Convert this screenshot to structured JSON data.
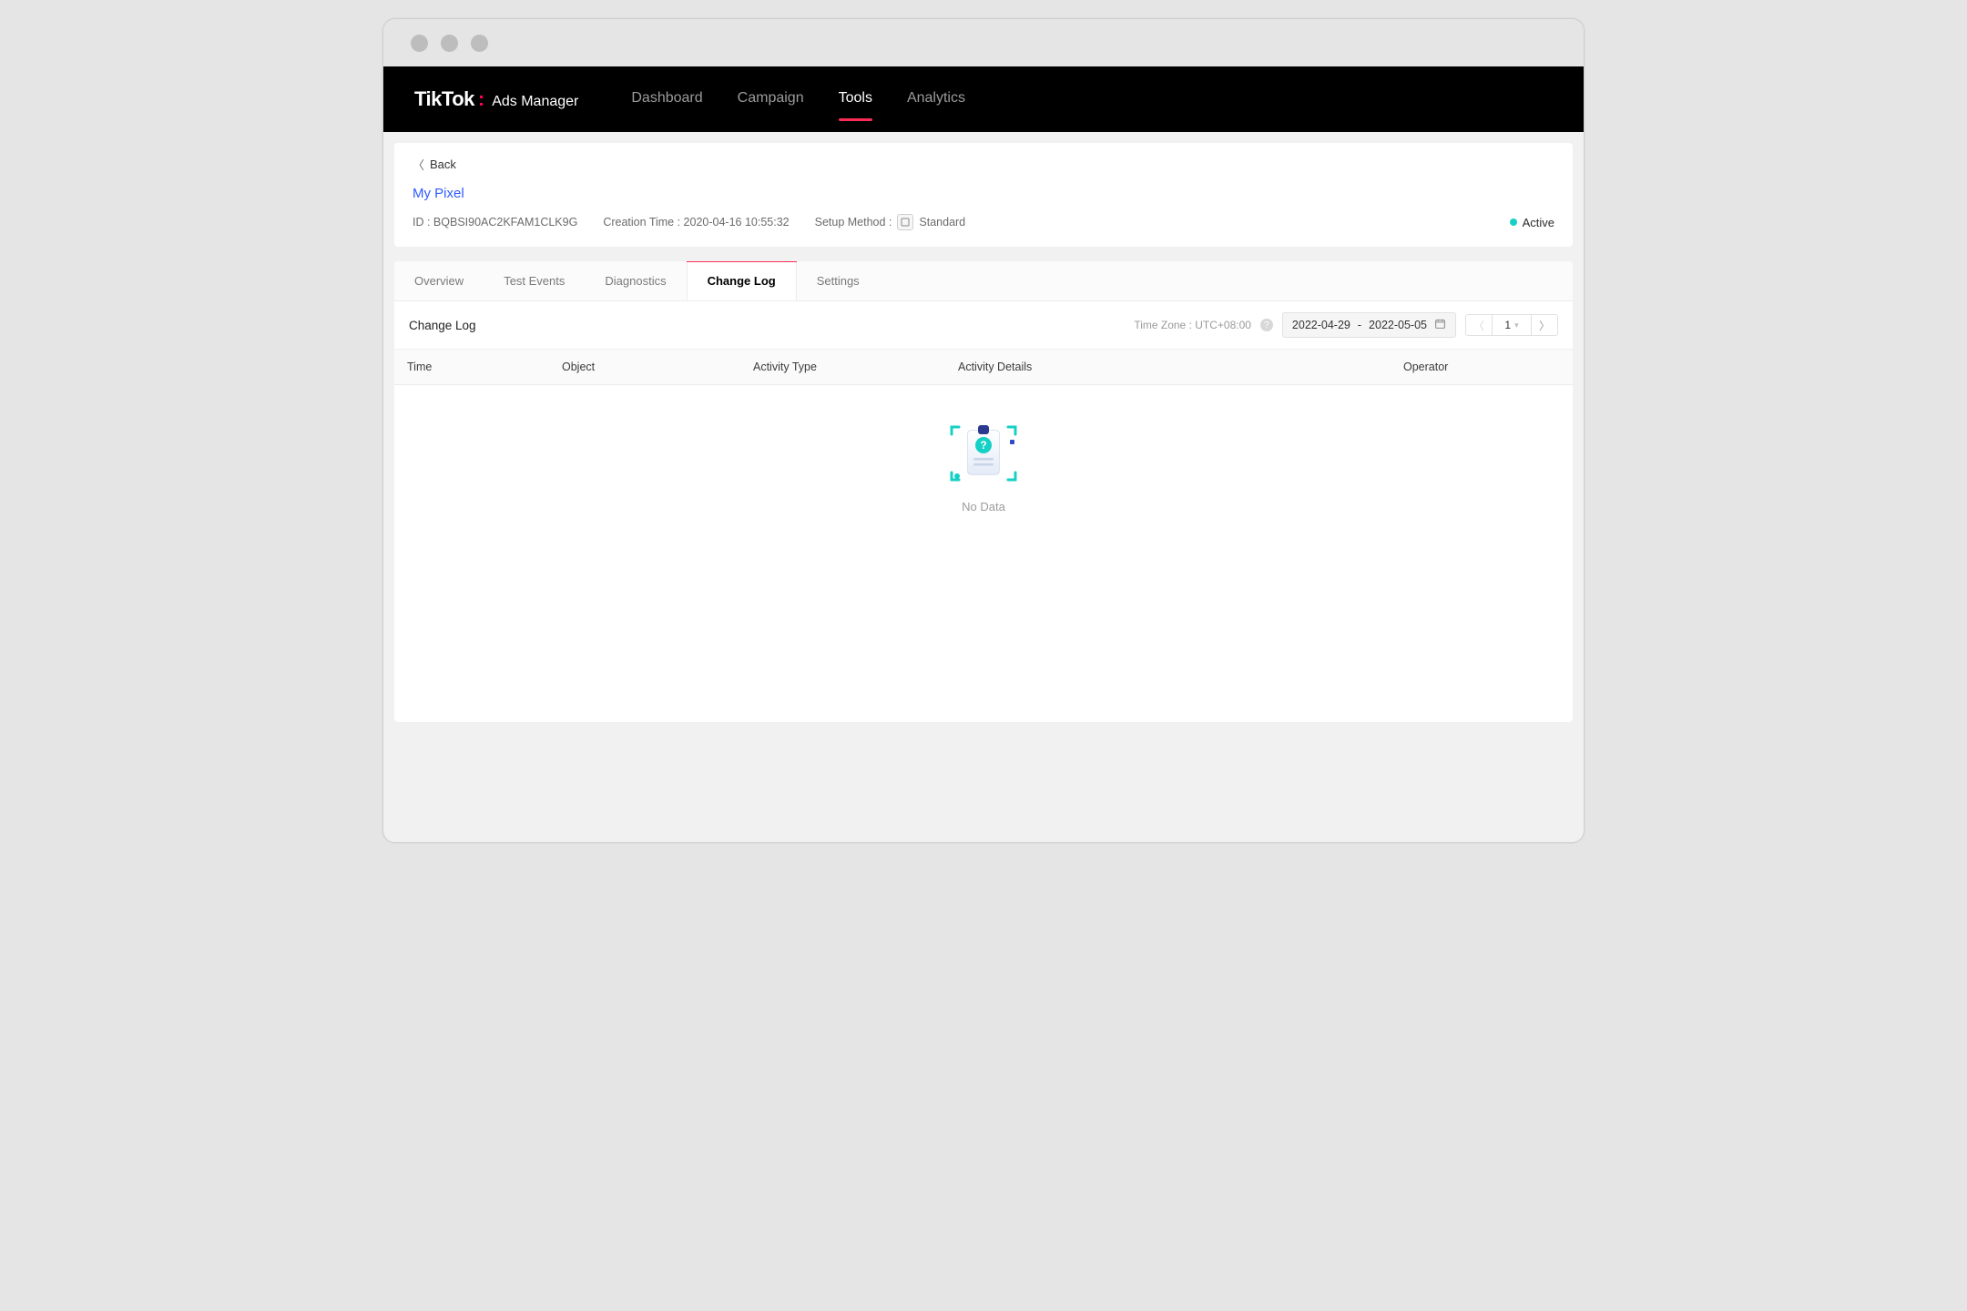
{
  "brand": {
    "name": "TikTok",
    "sub": "Ads Manager"
  },
  "nav": {
    "items": [
      {
        "label": "Dashboard"
      },
      {
        "label": "Campaign"
      },
      {
        "label": "Tools",
        "active": true
      },
      {
        "label": "Analytics"
      }
    ]
  },
  "pixelHeader": {
    "back": "Back",
    "name": "My Pixel",
    "idLabel": "ID : BQBSI90AC2KFAM1CLK9G",
    "creation": "Creation Time : 2020-04-16 10:55:32",
    "setupLabel": "Setup Method :",
    "setupValue": "Standard",
    "statusLabel": "Active"
  },
  "tabs": [
    {
      "label": "Overview"
    },
    {
      "label": "Test Events"
    },
    {
      "label": "Diagnostics"
    },
    {
      "label": "Change Log",
      "active": true
    },
    {
      "label": "Settings"
    }
  ],
  "toolbar": {
    "title": "Change Log",
    "tzLabel": "Time Zone : UTC+08:00",
    "dateStart": "2022-04-29",
    "dateSep": "-",
    "dateEnd": "2022-05-05",
    "page": "1"
  },
  "columns": {
    "time": "Time",
    "object": "Object",
    "activityType": "Activity Type",
    "activityDetails": "Activity Details",
    "operator": "Operator"
  },
  "empty": {
    "label": "No Data"
  }
}
